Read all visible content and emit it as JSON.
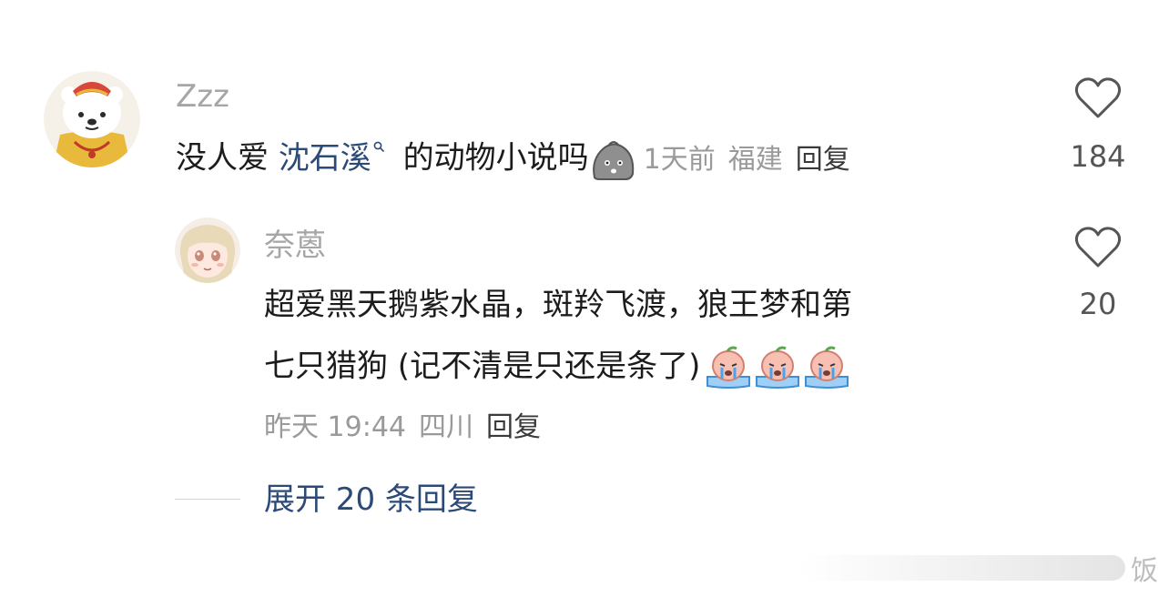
{
  "comment": {
    "username": "Zzz",
    "text_before": "没人爱 ",
    "mention": "沈石溪",
    "text_after": " 的动物小说吗",
    "emoji": "sad-dumpling-emoji",
    "time": "1天前",
    "location": "福建",
    "reply_label": "回复",
    "likes": "184"
  },
  "reply": {
    "username": "奈蒽",
    "line1": "超爱黑天鹅紫水晶，斑羚飞渡，狼王梦和第",
    "line2": "七只猎狗 (记不清是只还是条了)",
    "emoji": "crying-peach-emoji",
    "time": "昨天 19:44",
    "location": "四川",
    "reply_label": "回复",
    "likes": "20"
  },
  "expand_label": "展开 20 条回复",
  "watermark": "饭",
  "colors": {
    "accent": "#2c4a77",
    "username": "#a6a6a6",
    "meta": "#9a9a9a"
  },
  "icons": [
    "heart-outline-icon",
    "search-icon"
  ]
}
